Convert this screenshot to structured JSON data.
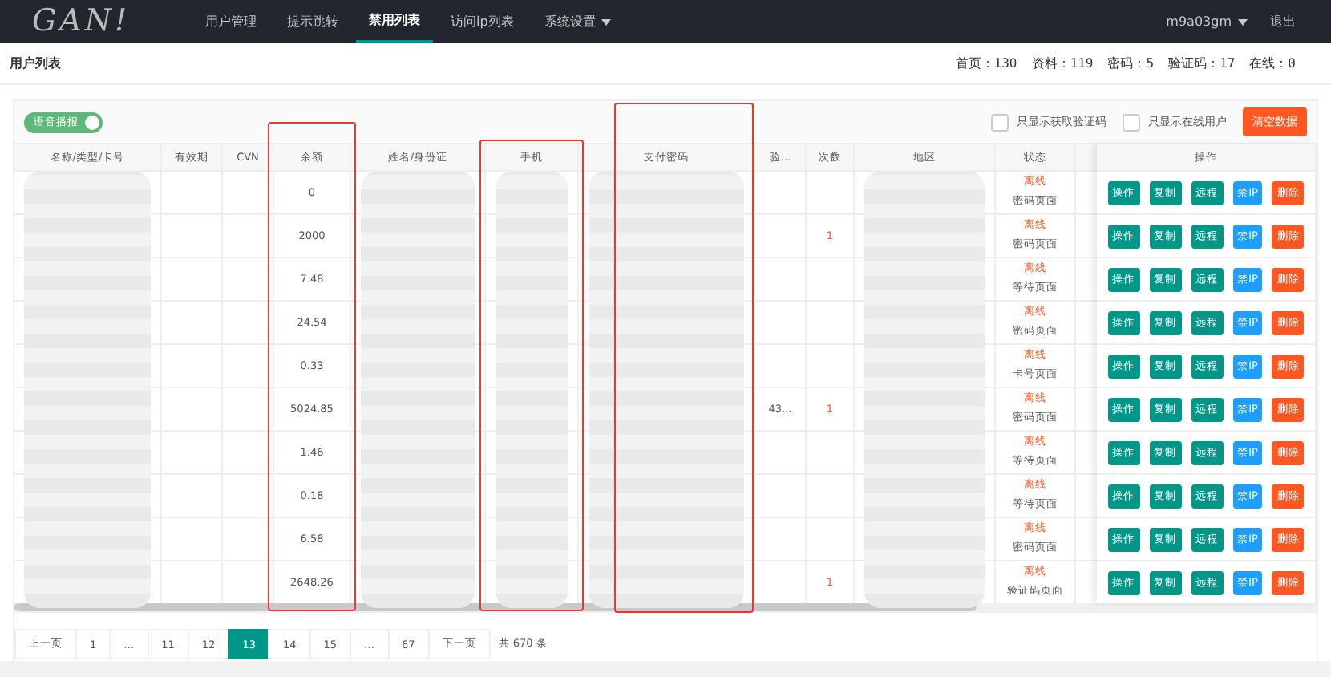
{
  "nav": {
    "logo": "GAN!",
    "tabs": [
      {
        "label": "用户管理",
        "selected": false
      },
      {
        "label": "提示跳转",
        "selected": false
      },
      {
        "label": "禁用列表",
        "selected": true
      },
      {
        "label": "访问ip列表",
        "selected": false
      },
      {
        "label": "系统设置",
        "selected": false,
        "dropdown": true
      }
    ],
    "user": "m9a03gm",
    "logout": "退出"
  },
  "page_title": "用户列表",
  "stats": [
    "首页：130",
    "资料：119",
    "密码：5",
    "验证码：17",
    "在线：0"
  ],
  "toolbar": {
    "voice_toggle": {
      "label": "语音播报",
      "on": true
    },
    "filters": [
      {
        "label": "只显示获取验证码",
        "checked": false
      },
      {
        "label": "只显示在线用户",
        "checked": false
      }
    ],
    "clear_button": "清空数据"
  },
  "table": {
    "columns": [
      {
        "label": "名称/类型/卡号",
        "blurred": true,
        "highlighted": false
      },
      {
        "label": "有效期",
        "blurred": false,
        "highlighted": false
      },
      {
        "label": "CVN",
        "blurred": false,
        "highlighted": false
      },
      {
        "label": "余额",
        "blurred": false,
        "highlighted": true
      },
      {
        "label": "姓名/身份证",
        "blurred": true,
        "highlighted": false
      },
      {
        "label": "手机",
        "blurred": true,
        "highlighted": true
      },
      {
        "label": "支付密码",
        "blurred": true,
        "highlighted": true
      },
      {
        "label": "验...",
        "blurred": false,
        "highlighted": false
      },
      {
        "label": "次数",
        "blurred": false,
        "highlighted": false
      },
      {
        "label": "地区",
        "blurred": true,
        "highlighted": false
      },
      {
        "label": "状态",
        "blurred": false,
        "highlighted": false
      },
      {
        "label": "操作",
        "blurred": false,
        "highlighted": false
      }
    ],
    "rows": [
      {
        "balance": "0",
        "status": "离线",
        "page": "密码页面",
        "actions": [
          {
            "label": "操作",
            "kind": "teal"
          },
          {
            "label": "复制",
            "kind": "teal"
          },
          {
            "label": "远程",
            "kind": "teal"
          },
          {
            "label": "禁IP",
            "kind": "blue"
          },
          {
            "label": "删除",
            "kind": "red"
          }
        ]
      },
      {
        "balance": "2000",
        "count": "1",
        "status": "离线",
        "page": "密码页面",
        "actions": [
          {
            "label": "操作",
            "kind": "teal"
          },
          {
            "label": "复制",
            "kind": "teal"
          },
          {
            "label": "远程",
            "kind": "teal"
          },
          {
            "label": "禁IP",
            "kind": "blue"
          },
          {
            "label": "删除",
            "kind": "red"
          }
        ]
      },
      {
        "balance": "7.48",
        "status": "离线",
        "page": "等待页面",
        "actions": [
          {
            "label": "操作",
            "kind": "teal"
          },
          {
            "label": "复制",
            "kind": "teal"
          },
          {
            "label": "远程",
            "kind": "teal"
          },
          {
            "label": "禁IP",
            "kind": "blue"
          },
          {
            "label": "删除",
            "kind": "red"
          }
        ]
      },
      {
        "balance": "24.54",
        "status": "离线",
        "page": "密码页面",
        "actions": [
          {
            "label": "操作",
            "kind": "teal"
          },
          {
            "label": "复制",
            "kind": "teal"
          },
          {
            "label": "远程",
            "kind": "teal"
          },
          {
            "label": "禁IP",
            "kind": "blue"
          },
          {
            "label": "删除",
            "kind": "red"
          }
        ]
      },
      {
        "balance": "0.33",
        "status": "离线",
        "page": "卡号页面",
        "actions": [
          {
            "label": "操作",
            "kind": "teal"
          },
          {
            "label": "复制",
            "kind": "teal"
          },
          {
            "label": "远程",
            "kind": "teal"
          },
          {
            "label": "禁IP",
            "kind": "blue"
          },
          {
            "label": "删除",
            "kind": "red"
          }
        ]
      },
      {
        "balance": "5024.85",
        "verify": "43...",
        "count": "1",
        "status": "离线",
        "page": "密码页面",
        "actions": [
          {
            "label": "操作",
            "kind": "teal"
          },
          {
            "label": "复制",
            "kind": "teal"
          },
          {
            "label": "远程",
            "kind": "teal"
          },
          {
            "label": "禁IP",
            "kind": "blue"
          },
          {
            "label": "删除",
            "kind": "red"
          }
        ]
      },
      {
        "balance": "1.46",
        "status": "离线",
        "page": "等待页面",
        "actions": [
          {
            "label": "操作",
            "kind": "teal"
          },
          {
            "label": "复制",
            "kind": "teal"
          },
          {
            "label": "远程",
            "kind": "teal"
          },
          {
            "label": "禁IP",
            "kind": "blue"
          },
          {
            "label": "删除",
            "kind": "red"
          }
        ]
      },
      {
        "balance": "0.18",
        "status": "离线",
        "page": "等待页面",
        "actions": [
          {
            "label": "操作",
            "kind": "teal"
          },
          {
            "label": "复制",
            "kind": "teal"
          },
          {
            "label": "远程",
            "kind": "teal"
          },
          {
            "label": "禁IP",
            "kind": "blue"
          },
          {
            "label": "删除",
            "kind": "red"
          }
        ]
      },
      {
        "balance": "6.58",
        "status": "离线",
        "page": "密码页面",
        "actions": [
          {
            "label": "操作",
            "kind": "teal"
          },
          {
            "label": "复制",
            "kind": "teal"
          },
          {
            "label": "远程",
            "kind": "teal"
          },
          {
            "label": "禁IP",
            "kind": "blue"
          },
          {
            "label": "删除",
            "kind": "red"
          }
        ]
      },
      {
        "balance": "2648.26",
        "count": "1",
        "status": "离线",
        "page": "验证码页面",
        "actions": [
          {
            "label": "操作",
            "kind": "teal"
          },
          {
            "label": "复制",
            "kind": "teal"
          },
          {
            "label": "远程",
            "kind": "teal"
          },
          {
            "label": "禁IP",
            "kind": "blue"
          },
          {
            "label": "删除",
            "kind": "red"
          }
        ]
      }
    ]
  },
  "pagination": {
    "pages": [
      {
        "label": "上一页",
        "selected": false
      },
      {
        "label": "1",
        "selected": false
      },
      {
        "label": "…",
        "selected": false
      },
      {
        "label": "11",
        "selected": false
      },
      {
        "label": "12",
        "selected": false
      },
      {
        "label": "13",
        "selected": true
      },
      {
        "label": "14",
        "selected": false
      },
      {
        "label": "15",
        "selected": false
      },
      {
        "label": "…",
        "selected": false
      },
      {
        "label": "67",
        "selected": false
      },
      {
        "label": "下一页",
        "selected": false
      }
    ],
    "total": "共 670 条"
  }
}
